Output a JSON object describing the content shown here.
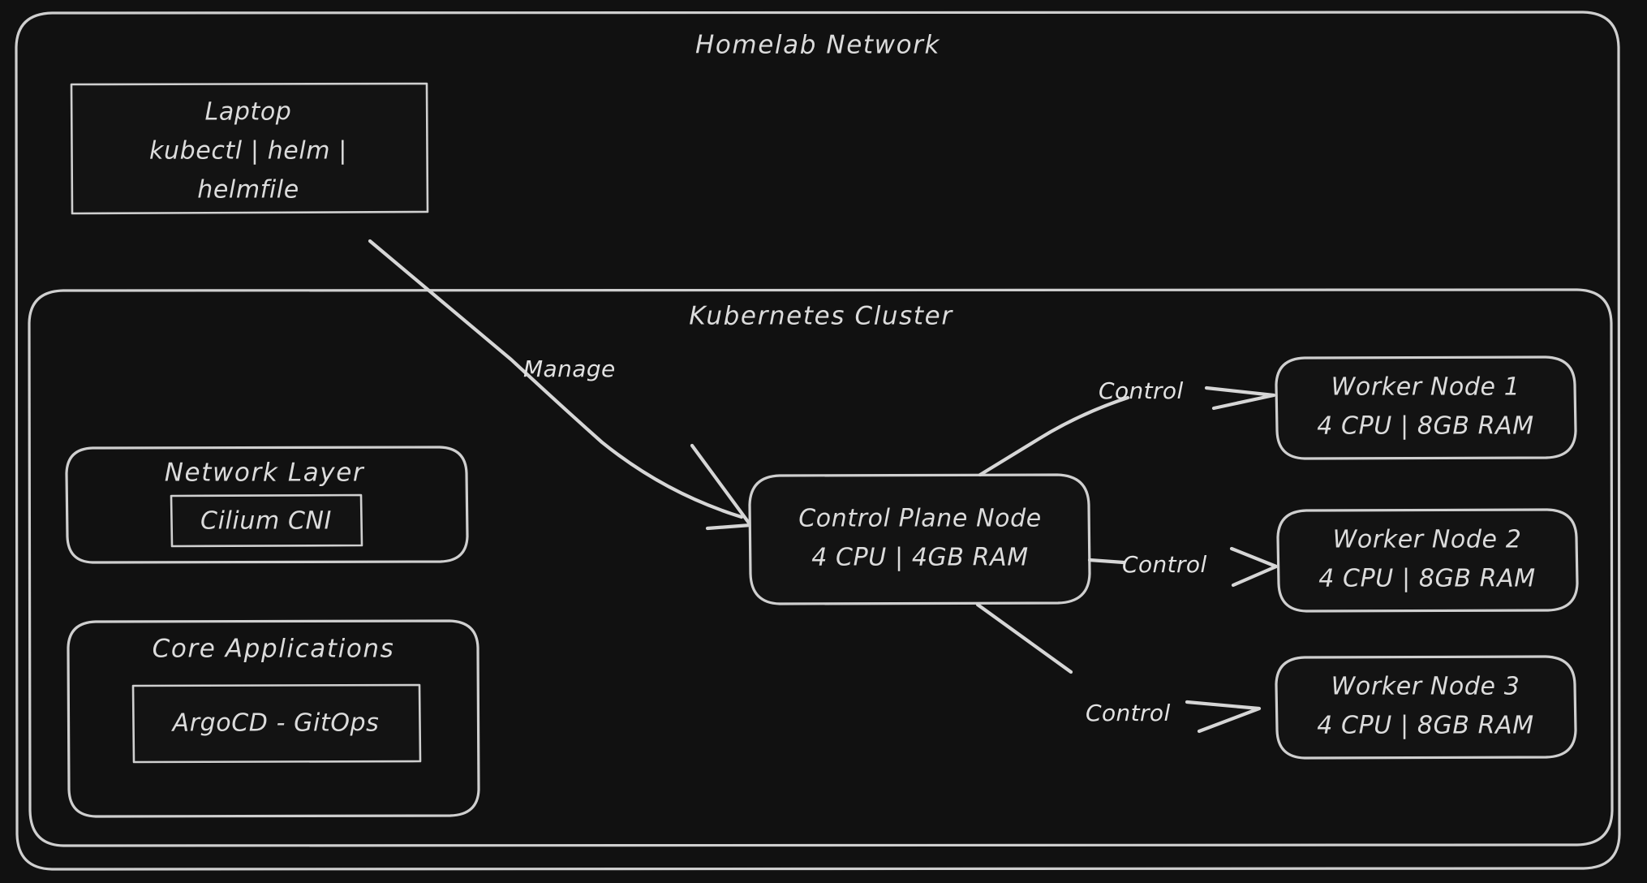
{
  "diagram": {
    "type": "architecture-flowchart",
    "theme": {
      "background": "#111111",
      "stroke": "#cfcfcf",
      "node_fill": "#131313",
      "text": "#dcdcdc",
      "edge": "#d6d6d6"
    },
    "containers": {
      "homelab": {
        "title": "Homelab Network"
      },
      "cluster": {
        "title": "Kubernetes Cluster"
      },
      "network_layer": {
        "title": "Network Layer"
      },
      "core_applications": {
        "title": "Core Applications"
      }
    },
    "nodes": {
      "laptop": {
        "line1": "Laptop",
        "line2": "kubectl | helm |",
        "line3": "helmfile"
      },
      "cilium": {
        "label": "Cilium CNI"
      },
      "argocd": {
        "label": "ArgoCD - GitOps"
      },
      "control_plane": {
        "line1": "Control Plane Node",
        "line2": "4 CPU | 4GB RAM"
      },
      "worker1": {
        "line1": "Worker Node 1",
        "line2": "4 CPU | 8GB RAM"
      },
      "worker2": {
        "line1": "Worker Node 2",
        "line2": "4 CPU | 8GB RAM"
      },
      "worker3": {
        "line1": "Worker Node 3",
        "line2": "4 CPU | 8GB RAM"
      }
    },
    "edges": {
      "manage": {
        "label": "Manage"
      },
      "control1": {
        "label": "Control"
      },
      "control2": {
        "label": "Control"
      },
      "control3": {
        "label": "Control"
      }
    }
  }
}
